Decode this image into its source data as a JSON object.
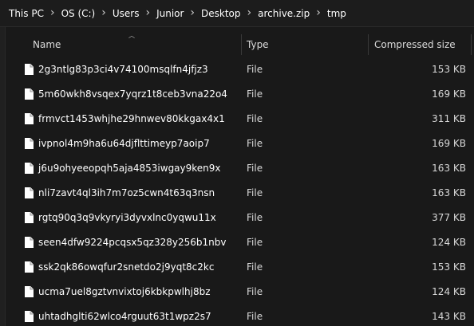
{
  "breadcrumb": [
    "This PC",
    "OS (C:)",
    "Users",
    "Junior",
    "Desktop",
    "archive.zip",
    "tmp"
  ],
  "columns": {
    "name": "Name",
    "type": "Type",
    "compressed_size": "Compressed size"
  },
  "sort": {
    "column": "name",
    "direction": "ascending"
  },
  "files": [
    {
      "name": "2g3ntlg83p3ci4v74100msqlfn4jfjz3",
      "type": "File",
      "size": "153 KB"
    },
    {
      "name": "5m60wkh8vsqex7yqrz1t8ceb3vna22o4",
      "type": "File",
      "size": "169 KB"
    },
    {
      "name": "frmvct1453whjhe29hnwev80kkgax4x1",
      "type": "File",
      "size": "311 KB"
    },
    {
      "name": "ivpnol4m9ha6u64djflttimeyp7aoip7",
      "type": "File",
      "size": "169 KB"
    },
    {
      "name": "j6u9ohyeeopqh5aja4853iwgay9ken9x",
      "type": "File",
      "size": "163 KB"
    },
    {
      "name": "nli7zavt4ql3ih7m7oz5cwn4t63q3nsn",
      "type": "File",
      "size": "163 KB"
    },
    {
      "name": "rgtq90q3q9vkyryi3dyvxlnc0yqwu11x",
      "type": "File",
      "size": "377 KB"
    },
    {
      "name": "seen4dfw9224pcqsx5qz328y256b1nbv",
      "type": "File",
      "size": "124 KB"
    },
    {
      "name": "ssk2qk86owqfur2snetdo2j9yqt8c2kc",
      "type": "File",
      "size": "153 KB"
    },
    {
      "name": "ucma7uel8gztvnvixtoj6kbkpwlhj8bz",
      "type": "File",
      "size": "124 KB"
    },
    {
      "name": "uhtadhglti62wlco4rguut63t1wpz2s7",
      "type": "File",
      "size": "143 KB"
    }
  ],
  "icons": {
    "file": "file-icon",
    "separator": "chevron-right-icon",
    "sort": "sort-up-icon"
  },
  "colors": {
    "background": "#191919",
    "text": "#ffffff",
    "secondary_text": "#d8d8d8"
  }
}
